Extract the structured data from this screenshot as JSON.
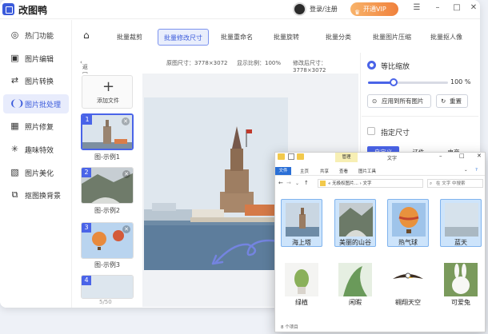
{
  "app": {
    "title": "改图鸭",
    "login": "登录/注册",
    "vip": "开通VIP"
  },
  "sidebar": {
    "items": [
      {
        "label": "热门功能",
        "icon": "hot-icon"
      },
      {
        "label": "图片编辑",
        "icon": "image-edit-icon"
      },
      {
        "label": "图片转换",
        "icon": "convert-icon"
      },
      {
        "label": "图片批处理",
        "icon": "batch-icon"
      },
      {
        "label": "照片修复",
        "icon": "repair-icon"
      },
      {
        "label": "趣味特效",
        "icon": "effects-icon"
      },
      {
        "label": "图片美化",
        "icon": "beautify-icon"
      },
      {
        "label": "抠图换背景",
        "icon": "cutout-icon"
      }
    ]
  },
  "tabs": [
    "批量裁剪",
    "批量修改尺寸",
    "批量重命名",
    "批量旋转",
    "批量分类",
    "批量图片压缩",
    "批量抠人像"
  ],
  "subbar": {
    "back": "返回",
    "orig_size": "原图尺寸：3778×3072",
    "ratio": "显示比例：100%",
    "new_size": "修改后尺寸：3778×3072"
  },
  "thumbs": {
    "add": "添加文件",
    "items": [
      {
        "num": "1",
        "label": "图-示例1"
      },
      {
        "num": "2",
        "label": "图-示例2"
      },
      {
        "num": "3",
        "label": "图-示例3"
      },
      {
        "num": "4",
        "label": ""
      }
    ],
    "pager": "5/50"
  },
  "panel": {
    "proportional": "等比缩放",
    "percent": "100 %",
    "scale_value": 0.3,
    "apply_all": "应用到所有图片",
    "reset": "重置",
    "custom_size": "指定尺寸",
    "size_tabs": [
      "自定义",
      "证件",
      "电商"
    ]
  },
  "explorer": {
    "manage_tab": "管理",
    "title": "文字",
    "ribbon": [
      "文件",
      "主页",
      "共享",
      "查看",
      "图片工具"
    ],
    "path": "« 无极权图片... › 文字",
    "search": "在 文字 中搜索",
    "files": [
      "海上塔",
      "美丽的山谷",
      "热气球",
      "蓝天",
      "绿植",
      "闲暇",
      "翱翔天空",
      "可爱兔"
    ],
    "status": "8 个项目",
    "colors": {
      "selected": "#cde4fb",
      "accent": "#4a64e8"
    }
  }
}
